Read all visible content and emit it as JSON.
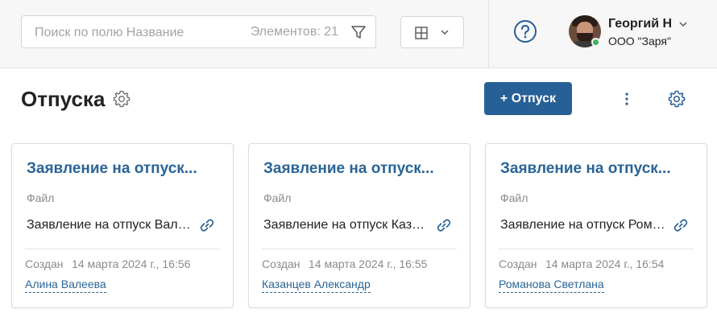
{
  "search": {
    "placeholder": "Поиск по полю Название",
    "count_label": "Элементов: 21"
  },
  "user": {
    "name": "Георгий Н",
    "company": "ООО \"Заря\"",
    "status_color": "#3fb35b"
  },
  "page": {
    "title": "Отпуска",
    "add_button": "+ Отпуск"
  },
  "icons": [
    "filter-icon",
    "grid-view-icon",
    "chevron-down-icon",
    "help-icon",
    "settings-gear-icon",
    "more-vertical-icon",
    "link-icon"
  ],
  "colors": {
    "accent": "#266096",
    "link": "#2a6496",
    "muted": "#8a8a8a"
  },
  "cards": [
    {
      "title": "Заявление на отпуск...",
      "file_label": "Файл",
      "file_name": "Заявление на отпуск Валеевой",
      "created_label": "Создан",
      "created_date": "14 марта 2024 г., 16:56",
      "author": "Алина Валеева"
    },
    {
      "title": "Заявление на отпуск...",
      "file_label": "Файл",
      "file_name": "Заявление на отпуск Казанцева",
      "created_label": "Создан",
      "created_date": "14 марта 2024 г., 16:55",
      "author": "Казанцев Александр"
    },
    {
      "title": "Заявление на отпуск...",
      "file_label": "Файл",
      "file_name": "Заявление на отпуск Романовой",
      "created_label": "Создан",
      "created_date": "14 марта 2024 г., 16:54",
      "author": "Романова Светлана"
    }
  ]
}
